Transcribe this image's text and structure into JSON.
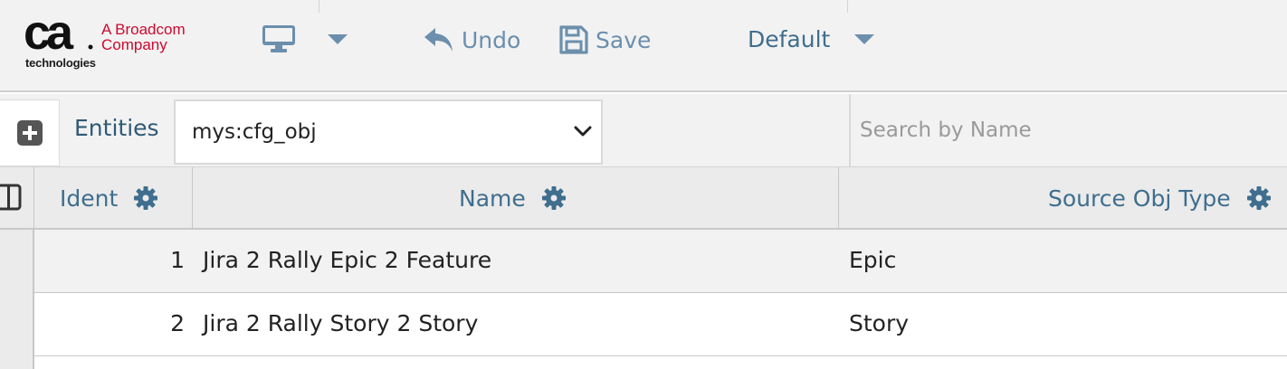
{
  "logo": {
    "mark": "ca",
    "subtitle": "technologies",
    "tagline_line1": "A Broadcom",
    "tagline_line2": "Company"
  },
  "toolbar": {
    "device_icon": "desktop-monitor-icon",
    "undo_label": "Undo",
    "save_label": "Save",
    "profile_value": "Default"
  },
  "entity_bar": {
    "entities_label": "Entities",
    "selected_entity": "mys:cfg_obj",
    "search_placeholder": "Search by Name"
  },
  "grid": {
    "columns": [
      {
        "label": "Ident"
      },
      {
        "label": "Name"
      },
      {
        "label": "Source Obj Type"
      }
    ],
    "rows": [
      {
        "ident": "1",
        "name": "Jira 2 Rally Epic 2 Feature",
        "source_obj_type": "Epic"
      },
      {
        "ident": "2",
        "name": "Jira 2 Rally Story 2 Story",
        "source_obj_type": "Story"
      }
    ]
  },
  "colors": {
    "accent": "#3f6e8e",
    "toolbar_button": "#6b8fad",
    "brand_red": "#cc092f",
    "header_bg": "#f2f2f2"
  }
}
